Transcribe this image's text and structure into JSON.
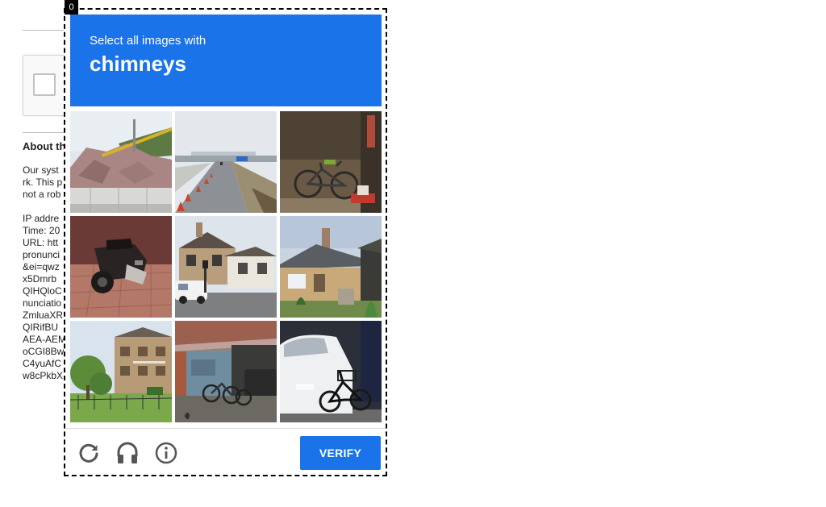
{
  "frame_index": "0",
  "background_page": {
    "heading": "About th",
    "paragraph_lines": [
      "Our syst",
      "rk. This p",
      "not a rob"
    ],
    "detail_lines": [
      "IP addre",
      "Time: 20",
      "URL: htt",
      "pronunci",
      "&ei=qwz",
      "x5Dmrb",
      "QIHQloC",
      "nunciatio",
      "ZmluaXR",
      "QIRifBU",
      "AEA-AEM",
      "oCGI8Bw",
      "C4yuAfC",
      "w8cPkbX"
    ]
  },
  "challenge": {
    "instruction": "Select all images with",
    "target": "chimneys",
    "tiles": [
      {
        "name": "tile-rocks-guardrail"
      },
      {
        "name": "tile-road-traffic-cones"
      },
      {
        "name": "tile-bicycle-wall"
      },
      {
        "name": "tile-scooter"
      },
      {
        "name": "tile-house-street-van"
      },
      {
        "name": "tile-house-chimney"
      },
      {
        "name": "tile-apartment-building"
      },
      {
        "name": "tile-carport-bicycles"
      },
      {
        "name": "tile-bicycle-car"
      }
    ],
    "verify_label": "VERIFY",
    "icons": [
      "reload-icon",
      "headphones-icon",
      "info-icon"
    ]
  },
  "colors": {
    "accent": "#1a73e8",
    "text_on_accent": "#ffffff",
    "icon_gray": "#555555"
  }
}
